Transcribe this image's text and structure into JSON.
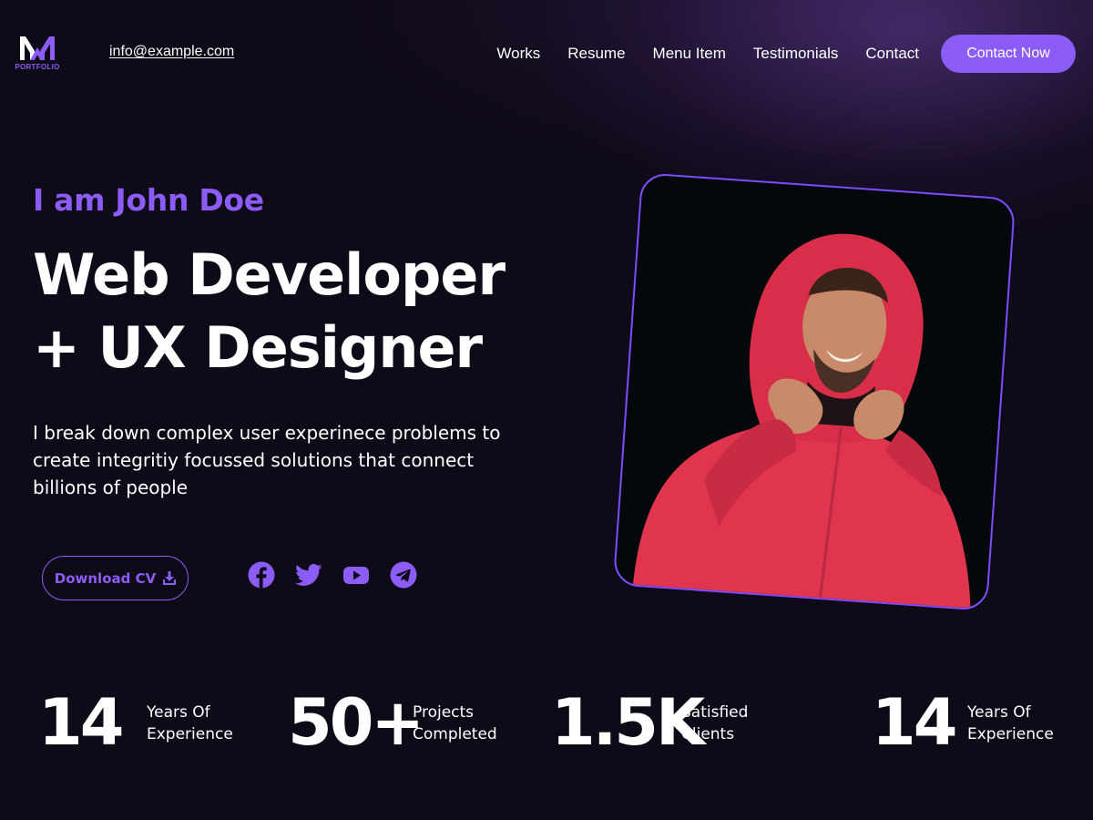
{
  "brand": {
    "logo_text": "PORTFOLIO",
    "accent_color": "#8b5cf6"
  },
  "header": {
    "email": "info@example.com",
    "nav": [
      "Works",
      "Resume",
      "Menu Item",
      "Testimonials",
      "Contact"
    ],
    "cta_label": "Contact Now"
  },
  "hero": {
    "greeting": "I am John Doe",
    "headline_line1": "Web Developer",
    "headline_line2": "+ UX Designer",
    "description": "I break down complex user experinece problems to create integritiy focussed solutions that connect billions of people",
    "download_label": "Download CV",
    "download_icon": "download-icon",
    "socials": [
      {
        "name": "facebook-icon"
      },
      {
        "name": "twitter-icon"
      },
      {
        "name": "youtube-icon"
      },
      {
        "name": "telegram-icon"
      }
    ]
  },
  "stats": [
    {
      "value": "14",
      "label_line1": "Years Of",
      "label_line2": "Experience"
    },
    {
      "value": "50+",
      "label_line1": "Projects",
      "label_line2": "Completed"
    },
    {
      "value": "1.5K",
      "label_line1": "Satisfied",
      "label_line2": "Clients"
    },
    {
      "value": "14",
      "label_line1": "Years Of",
      "label_line2": "Experience"
    }
  ]
}
